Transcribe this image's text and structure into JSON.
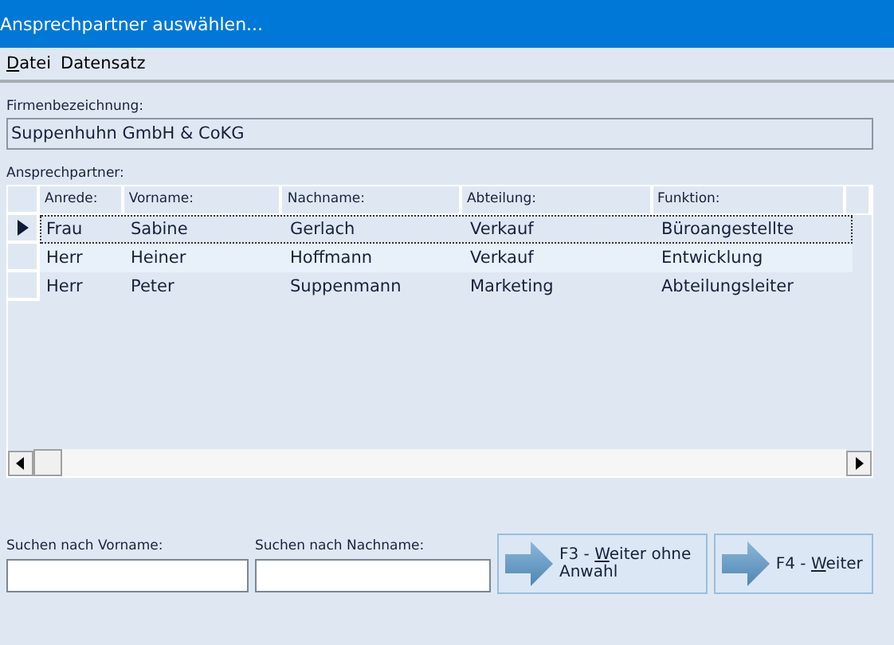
{
  "window": {
    "title": "Ansprechpartner auswählen..."
  },
  "menu": [
    {
      "access_key": "D",
      "rest": "atei"
    },
    {
      "label": "Datensatz"
    }
  ],
  "company": {
    "label": "Firmenbezeichnung:",
    "value": "Suppenhuhn GmbH & CoKG"
  },
  "contacts": {
    "label": "Ansprechpartner:",
    "columns": [
      "Anrede:",
      "Vorname:",
      "Nachname:",
      "Abteilung:",
      "Funktion:"
    ],
    "rows": [
      {
        "cells": [
          "Frau",
          "Sabine",
          "Gerlach",
          "Verkauf",
          "Büroangestellte"
        ],
        "selected": true
      },
      {
        "cells": [
          "Herr",
          "Heiner",
          "Hoffmann",
          "Verkauf",
          "Entwicklung"
        ],
        "selected": false
      },
      {
        "cells": [
          "Herr",
          "Peter",
          "Suppenmann",
          "Marketing",
          "Abteilungsleiter"
        ],
        "selected": false
      }
    ]
  },
  "search": [
    {
      "label": "Suchen nach Vorname:"
    },
    {
      "label": "Suchen nach Nachname:"
    }
  ],
  "buttons": [
    {
      "label": "F3 - ",
      "access_key": "W",
      "rest": "eiter ohne Anwahl"
    },
    {
      "label": "F4 - ",
      "access_key": "W",
      "rest": "eiter"
    }
  ]
}
